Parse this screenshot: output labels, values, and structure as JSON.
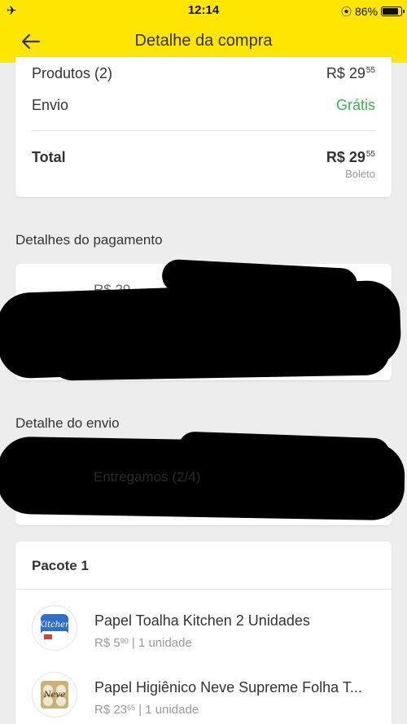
{
  "status_bar": {
    "time": "12:14",
    "battery_percent": "86%",
    "battery_level": 0.86
  },
  "header": {
    "title": "Detalhe da compra",
    "background": "#ffe600"
  },
  "summary": {
    "products_label": "Produtos (2)",
    "products_price_int": "R$ 29",
    "products_price_cents": "55",
    "shipping_label": "Envio",
    "shipping_value": "Grátis",
    "total_label": "Total",
    "total_price_int": "R$ 29",
    "total_price_cents": "55",
    "payment_method": "Boleto"
  },
  "payment_section": {
    "title": "Detalhes do pagamento",
    "redacted_text": "R$ 29"
  },
  "shipping_section": {
    "title": "Detalhe do envio",
    "redacted_text": "Entregamos (2/4)"
  },
  "package": {
    "title": "Pacote 1",
    "items": [
      {
        "name": "Papel Toalha Kitchen 2 Unidades",
        "price_int": "R$ 5",
        "price_cents": "90",
        "quantity": "| 1 unidade",
        "thumb_label": "Kitchen"
      },
      {
        "name": "Papel Higiênico Neve Supreme Folha T...",
        "price_int": "R$ 23",
        "price_cents": "65",
        "quantity": "| 1 unidade",
        "thumb_label": "Neve"
      }
    ]
  },
  "colors": {
    "accent": "#ffe600",
    "free_shipping": "#39b54a",
    "background": "#ededed"
  }
}
